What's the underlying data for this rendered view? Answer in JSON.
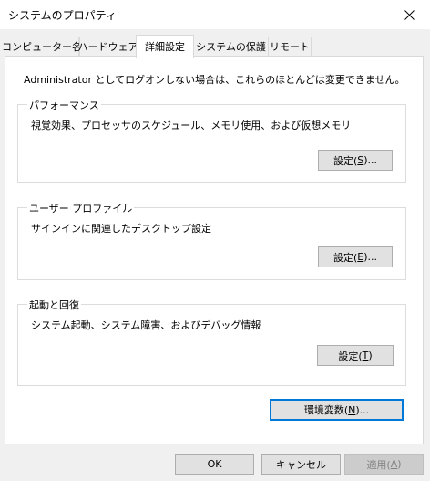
{
  "window": {
    "title": "システムのプロパティ"
  },
  "tabs": [
    {
      "label": "コンピューター名"
    },
    {
      "label": "ハードウェア"
    },
    {
      "label": "詳細設定",
      "active": true
    },
    {
      "label": "システムの保護"
    },
    {
      "label": "リモート"
    }
  ],
  "admin_notice": "Administrator としてログオンしない場合は、これらのほとんどは変更できません。",
  "groups": {
    "performance": {
      "title": "パフォーマンス",
      "description": "視覚効果、プロセッサのスケジュール、メモリ使用、および仮想メモリ",
      "button": {
        "prefix": "設定(",
        "mnemonic": "S",
        "suffix": ")..."
      }
    },
    "user_profile": {
      "title": "ユーザー プロファイル",
      "description": "サインインに関連したデスクトップ設定",
      "button": {
        "prefix": "設定(",
        "mnemonic": "E",
        "suffix": ")..."
      }
    },
    "startup_recovery": {
      "title": "起動と回復",
      "description": "システム起動、システム障害、およびデバッグ情報",
      "button": {
        "prefix": "設定(",
        "mnemonic": "T",
        "suffix": ")"
      }
    }
  },
  "env_button": {
    "prefix": "環境変数(",
    "mnemonic": "N",
    "suffix": ")..."
  },
  "footer": {
    "ok": "OK",
    "cancel": "キャンセル",
    "apply": {
      "prefix": "適用(",
      "mnemonic": "A",
      "suffix": ")"
    }
  },
  "icons": {
    "close": "close-icon"
  }
}
